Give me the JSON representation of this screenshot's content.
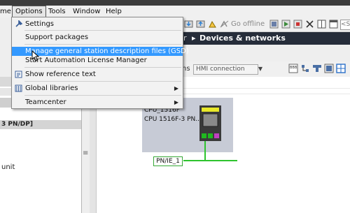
{
  "menubar": {
    "items": [
      "me",
      "Options",
      "Tools",
      "Window",
      "Help"
    ]
  },
  "options_menu": {
    "settings": "Settings",
    "support_packages": "Support packages",
    "manage_gsd": "Manage general station description files (GSD)",
    "license_manager": "Start Automation License Manager",
    "show_reference_text": "Show reference text",
    "global_libraries": "Global libraries",
    "teamcenter": "Teamcenter"
  },
  "toolbar": {
    "go_offline": "Go offline",
    "search_placeholder": "<Sea"
  },
  "header": {
    "breadcrumb_fragment": "r",
    "separator": "▸",
    "title": "Devices & networks"
  },
  "editor_toolbar": {
    "label_fragment": "ns",
    "hmi_connection": "HMI connection"
  },
  "left_panel": {
    "header_fragment": "3 PN/DP]",
    "item_fragment": "unit"
  },
  "device": {
    "name": "CPU_1516F",
    "type": "CPU 1516F-3 PN...",
    "network": "PN/IE_1"
  },
  "colors": {
    "highlight": "#3399ff",
    "header_band": "#262d3a",
    "network_green": "#2ec42e"
  }
}
